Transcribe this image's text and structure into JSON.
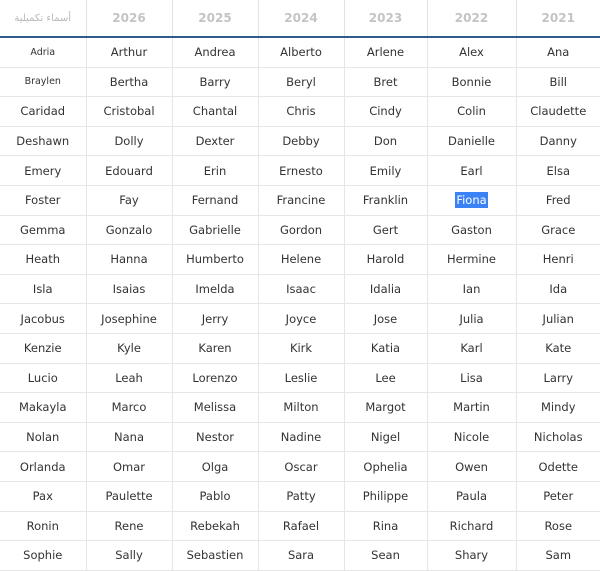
{
  "header": {
    "extra_label": "أسماء تكميلية",
    "years": [
      "2026",
      "2025",
      "2024",
      "2023",
      "2022",
      "2021"
    ]
  },
  "rows": [
    [
      "Adria",
      "Arthur",
      "Andrea",
      "Alberto",
      "Arlene",
      "Alex",
      "Ana"
    ],
    [
      "Braylen",
      "Bertha",
      "Barry",
      "Beryl",
      "Bret",
      "Bonnie",
      "Bill"
    ],
    [
      "Caridad",
      "Cristobal",
      "Chantal",
      "Chris",
      "Cindy",
      "Colin",
      "Claudette"
    ],
    [
      "Deshawn",
      "Dolly",
      "Dexter",
      "Debby",
      "Don",
      "Danielle",
      "Danny"
    ],
    [
      "Emery",
      "Edouard",
      "Erin",
      "Ernesto",
      "Emily",
      "Earl",
      "Elsa"
    ],
    [
      "Foster",
      "Fay",
      "Fernand",
      "Francine",
      "Franklin",
      "Fiona",
      "Fred"
    ],
    [
      "Gemma",
      "Gonzalo",
      "Gabrielle",
      "Gordon",
      "Gert",
      "Gaston",
      "Grace"
    ],
    [
      "Heath",
      "Hanna",
      "Humberto",
      "Helene",
      "Harold",
      "Hermine",
      "Henri"
    ],
    [
      "Isla",
      "Isaias",
      "Imelda",
      "Isaac",
      "Idalia",
      "Ian",
      "Ida"
    ],
    [
      "Jacobus",
      "Josephine",
      "Jerry",
      "Joyce",
      "Jose",
      "Julia",
      "Julian"
    ],
    [
      "Kenzie",
      "Kyle",
      "Karen",
      "Kirk",
      "Katia",
      "Karl",
      "Kate"
    ],
    [
      "Lucio",
      "Leah",
      "Lorenzo",
      "Leslie",
      "Lee",
      "Lisa",
      "Larry"
    ],
    [
      "Makayla",
      "Marco",
      "Melissa",
      "Milton",
      "Margot",
      "Martin",
      "Mindy"
    ],
    [
      "Nolan",
      "Nana",
      "Nestor",
      "Nadine",
      "Nigel",
      "Nicole",
      "Nicholas"
    ],
    [
      "Orlanda",
      "Omar",
      "Olga",
      "Oscar",
      "Ophelia",
      "Owen",
      "Odette"
    ],
    [
      "Pax",
      "Paulette",
      "Pablo",
      "Patty",
      "Philippe",
      "Paula",
      "Peter"
    ],
    [
      "Ronin",
      "Rene",
      "Rebekah",
      "Rafael",
      "Rina",
      "Richard",
      "Rose"
    ],
    [
      "Sophie",
      "Sally",
      "Sebastien",
      "Sara",
      "Sean",
      "Shary",
      "Sam"
    ]
  ],
  "selected": {
    "row": 5,
    "col": 5,
    "color": "#3b82f6"
  }
}
